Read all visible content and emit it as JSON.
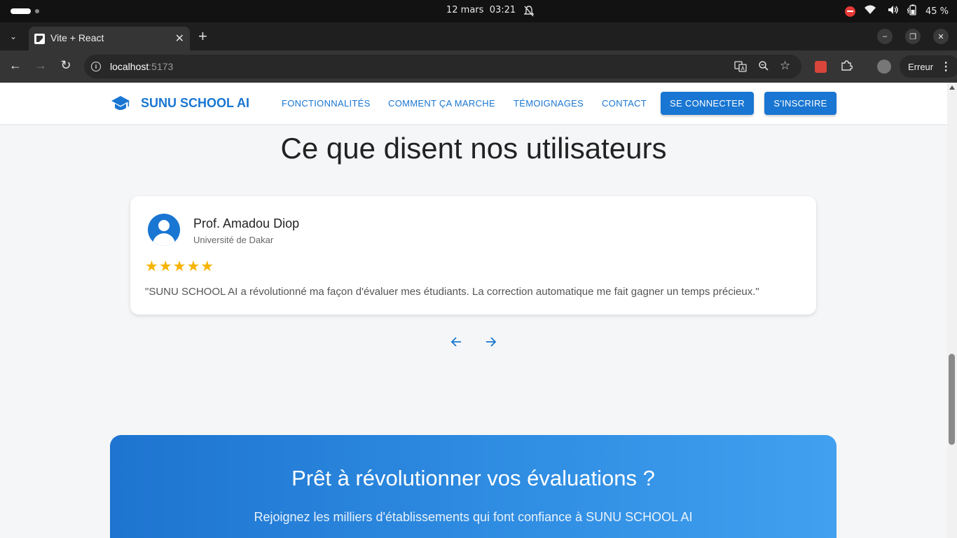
{
  "os_bar": {
    "date": "12 mars",
    "time": "03:21",
    "battery": "45 %"
  },
  "browser": {
    "tab_title": "Vite + React",
    "url_host": "localhost",
    "url_port": ":5173",
    "error_label": "Erreur"
  },
  "navbar": {
    "brand": "SUNU SCHOOL AI",
    "links": [
      "FONCTIONNALITÉS",
      "COMMENT ÇA MARCHE",
      "TÉMOIGNAGES",
      "CONTACT"
    ],
    "login_label": "SE CONNECTER",
    "signup_label": "S'INSCRIRE",
    "brand_color": "#1976d2"
  },
  "testimonials": {
    "title": "Ce que disent nos utilisateurs",
    "name": "Prof. Amadou Diop",
    "organization": "Université de Dakar",
    "rating": 5,
    "stars": "★★★★★",
    "quote": "\"SUNU SCHOOL AI a révolutionné ma façon d'évaluer mes étudiants. La correction automatique me fait gagner un temps précieux.\"",
    "star_color": "#f6b400"
  },
  "cta": {
    "title": "Prêt à révolutionner vos évaluations ?",
    "subtitle": "Rejoignez les milliers d'établissements qui font confiance à SUNU SCHOOL AI"
  }
}
